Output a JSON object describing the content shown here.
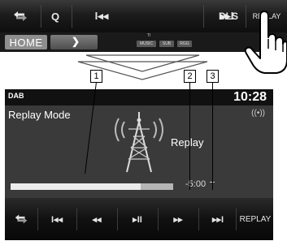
{
  "top_screen": {
    "buttons": [
      {
        "id": "mode",
        "label": "",
        "icon": "swap-arrows-icon"
      },
      {
        "id": "search",
        "label": "Q",
        "icon": "search-icon"
      },
      {
        "id": "prev",
        "label": "I◂◂",
        "icon": "skip-previous-icon"
      },
      {
        "id": "next",
        "label": "▸▸I",
        "icon": "skip-next-icon"
      },
      {
        "id": "dls",
        "label": "DLS"
      },
      {
        "id": "replay",
        "label": "REPLAY"
      }
    ],
    "home_label": "HOME",
    "next_page_symbol": "❯",
    "ti_label": "TI",
    "chips": [
      "MUSIC",
      "SUB",
      "RGG"
    ]
  },
  "callouts": [
    "1",
    "2",
    "3"
  ],
  "main_screen": {
    "source": "DAB",
    "clock": "10:28",
    "mode_text": "Replay Mode",
    "signal_icon": "((•))",
    "replay_text": "Replay",
    "time_text": "-5:00",
    "progress": 0.8,
    "bottom_buttons": [
      {
        "id": "mode",
        "label": "",
        "icon": "swap-arrows-icon"
      },
      {
        "id": "prev-track",
        "label": "I◂◂",
        "icon": "skip-previous-icon"
      },
      {
        "id": "rewind",
        "label": "◂◂",
        "icon": "rewind-icon"
      },
      {
        "id": "play-pause",
        "label": "▸II",
        "icon": "play-pause-icon"
      },
      {
        "id": "fast-forward",
        "label": "▸▸",
        "icon": "fast-forward-icon"
      },
      {
        "id": "next-track",
        "label": "▸▸I",
        "icon": "skip-next-icon"
      },
      {
        "id": "replay",
        "label": "REPLAY"
      }
    ]
  }
}
